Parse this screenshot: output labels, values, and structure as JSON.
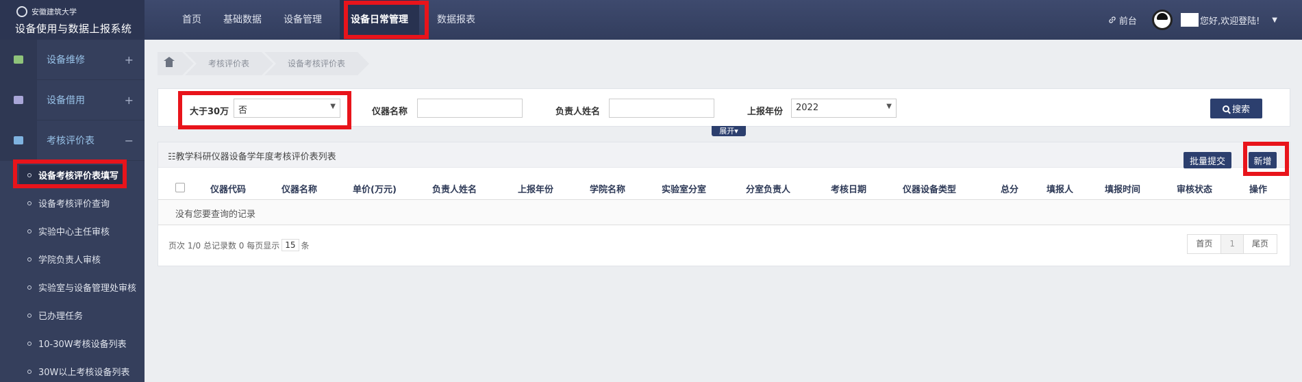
{
  "brand": {
    "university": "安徽建筑大学",
    "system_title": "设备使用与数据上报系统"
  },
  "topnav": {
    "items": [
      {
        "label": "首页"
      },
      {
        "label": "基础数据"
      },
      {
        "label": "设备管理"
      },
      {
        "label": "设备日常管理",
        "active": true
      },
      {
        "label": "数据报表"
      }
    ],
    "front_link": "前台",
    "greeting": "您好,欢迎登陆!"
  },
  "sidebar": {
    "groups": [
      {
        "label": "设备维修",
        "sign": "+",
        "icon_color": "#8fc37a"
      },
      {
        "label": "设备借用",
        "sign": "+",
        "icon_color": "#a9a6d8"
      },
      {
        "label": "考核评价表",
        "sign": "−",
        "icon_color": "#7fb3e0"
      }
    ],
    "sub_items": [
      {
        "label": "设备考核评价表填写",
        "active": true
      },
      {
        "label": "设备考核评价查询"
      },
      {
        "label": "实验中心主任审核"
      },
      {
        "label": "学院负责人审核"
      },
      {
        "label": "实验室与设备管理处审核"
      },
      {
        "label": "已办理任务"
      },
      {
        "label": "10-30W考核设备列表"
      },
      {
        "label": "30W以上考核设备列表"
      }
    ]
  },
  "breadcrumb": [
    "考核评价表",
    "设备考核评价表"
  ],
  "search": {
    "over_300k_label": "大于30万",
    "over_300k_value": "否",
    "instrument_name_label": "仪器名称",
    "instrument_name_value": "",
    "person_label": "负责人姓名",
    "person_value": "",
    "year_label": "上报年份",
    "year_value": "2022",
    "search_button": "搜索",
    "expand_button": "展开"
  },
  "table": {
    "title": "教学科研仪器设备学年度考核评价表列表",
    "batch_submit": "批量提交",
    "add_button": "新增",
    "columns": [
      "仪器代码",
      "仪器名称",
      "单价(万元)",
      "负责人姓名",
      "上报年份",
      "学院名称",
      "实验室分室",
      "分室负责人",
      "考核日期",
      "仪器设备类型",
      "总分",
      "填报人",
      "填报时间",
      "审核状态",
      "操作"
    ],
    "empty_text": "没有您要查询的记录",
    "pager_info_prefix": "页次 1/0 总记录数 0 每页显示",
    "page_size": "15",
    "pager_info_suffix": "条",
    "pager": {
      "first": "首页",
      "current": "1",
      "last": "尾页"
    }
  },
  "colors": {
    "topbar": "#3a4668",
    "sidebar": "#353f5c",
    "primary_button": "#2c3f6e",
    "highlight_box": "#e8141b"
  }
}
